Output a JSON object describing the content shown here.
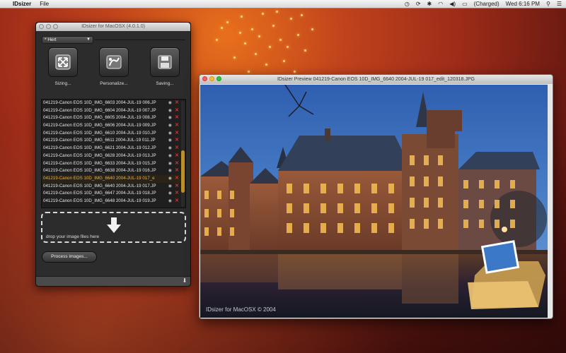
{
  "menubar": {
    "app_name": "IDsizer",
    "menus": [
      "File"
    ],
    "battery": "(Charged)",
    "clock": "Wed 6:16 PM"
  },
  "main_window": {
    "title": "IDsizer for MacOSX (4.0.1.0)",
    "profile": "* Hert",
    "tools": {
      "sizing": "Sizing...",
      "personalize": "Personalize...",
      "saving": "Saving..."
    },
    "files": [
      "041219-Canon EOS 10D_IMG_6603 2004-JUL-19 006.JP",
      "041219-Canon EOS 10D_IMG_6604 2004-JUL-19 007.JP",
      "041219-Canon EOS 10D_IMG_6605 2004-JUL-19 008.JP",
      "041219-Canon EOS 10D_IMG_6606 2004-JUL-19 009.JP",
      "041219-Canon EOS 10D_IMG_6610 2004-JUL-19 010.JP",
      "041219-Canon EOS 10D_IMG_6611 2004-JUL-19 011.JP",
      "041219-Canon EOS 10D_IMG_6621 2004-JUL-19 012.JP",
      "041219-Canon EOS 10D_IMG_6628 2004-JUL-19 013.JP",
      "041219-Canon EOS 10D_IMG_6633 2004-JUL-19 015.JP",
      "041219-Canon EOS 10D_IMG_6638 2004-JUL-19 016.JP",
      "041219-Canon EOS 10D_IMG_6640 2004-JUL-19 017_e",
      "041219-Canon EOS 10D_IMG_6640 2004-JUL-19 017.JP",
      "041219-Canon EOS 10D_IMG_6647 2004-JUL-19 018.JP",
      "041219-Canon EOS 10D_IMG_6648 2004-JUL-19 019.JP"
    ],
    "selected_index": 10,
    "dropzone_text": "drop your image files here",
    "process_button": "Process images..."
  },
  "preview_window": {
    "title": "IDsizer Preview 041219-Canon EOS 10D_IMG_6640 2004-JUL-19 017_edit_120318.JPG",
    "watermark": "IDsizer for MacOSX © 2004"
  },
  "colors": {
    "selected_file": "#f0b040",
    "delete_x": "#e03030",
    "accent_scroll": "#b8902c"
  }
}
